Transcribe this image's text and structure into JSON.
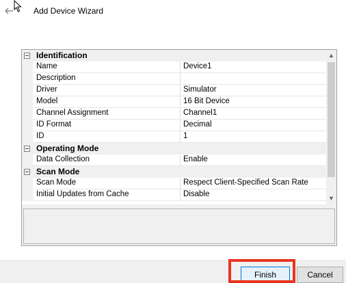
{
  "window": {
    "title": "Add Device Wizard"
  },
  "categories": [
    {
      "label": "Identification",
      "props": [
        {
          "name": "Name",
          "value": "Device1"
        },
        {
          "name": "Description",
          "value": ""
        },
        {
          "name": "Driver",
          "value": "Simulator"
        },
        {
          "name": "Model",
          "value": "16 Bit Device"
        },
        {
          "name": "Channel Assignment",
          "value": "Channel1"
        },
        {
          "name": "ID Format",
          "value": "Decimal"
        },
        {
          "name": "ID",
          "value": "1"
        }
      ]
    },
    {
      "label": "Operating Mode",
      "props": [
        {
          "name": "Data Collection",
          "value": "Enable"
        }
      ]
    },
    {
      "label": "Scan Mode",
      "props": [
        {
          "name": "Scan Mode",
          "value": "Respect Client-Specified Scan Rate"
        },
        {
          "name": "Initial Updates from Cache",
          "value": "Disable"
        }
      ]
    }
  ],
  "buttons": {
    "finish": "Finish",
    "cancel": "Cancel"
  },
  "colors": {
    "highlight": "#e8351f",
    "accent": "#0078d7"
  }
}
